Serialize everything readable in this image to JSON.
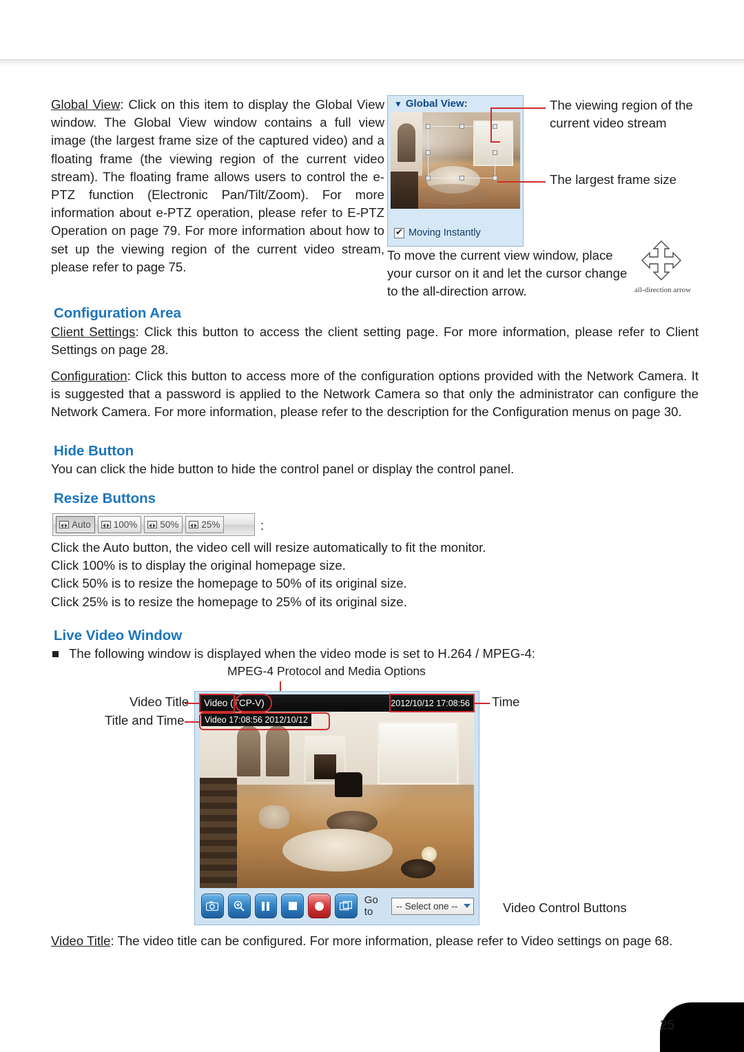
{
  "page": {
    "number": "25"
  },
  "intro": {
    "label": "Global View",
    "text": ": Click on this item to display the Global View window. The Global View window contains a full view image (the largest frame size of the captured video) and a floating frame (the viewing region of the current video stream). The floating frame allows users to control the e-PTZ function (Electronic Pan/Tilt/Zoom). For more information about e-PTZ operation, please refer to E-PTZ Operation on page 79. For more information about how to set up the viewing region of the current video stream, please refer to page 75."
  },
  "global_view_figure": {
    "title": "Global View:",
    "checkbox_label": "Moving Instantly",
    "annotations": {
      "viewing_region": "The viewing region of the current video stream",
      "largest_frame": "The largest frame size",
      "move_view": "To move the current view window, place your cursor on it and let the cursor change to the all-direction arrow.",
      "arrow_caption": "all-direction arrow"
    }
  },
  "configuration_area": {
    "heading": "Configuration Area",
    "client_settings_label": "Client Settings",
    "client_settings_text": ": Click this button to access the client setting page. For more information, please refer to Client Settings on page 28.",
    "configuration_label": "Configuration",
    "configuration_text": ": Click this button to access more of the configuration options provided with the Network Camera. It is suggested that a password is applied to the Network Camera so that only the administrator can configure the Network Camera. For more information, please refer to the description for the Configuration menus on page 30."
  },
  "hide_button": {
    "heading": "Hide Button",
    "text": "You can click the hide button to hide the control panel or display the control panel."
  },
  "resize_buttons": {
    "heading": "Resize Buttons",
    "buttons": [
      "Auto",
      "100%",
      "50%",
      "25%"
    ],
    "colon": ":",
    "lines": [
      "Click the Auto button, the video cell will resize automatically to fit the monitor.",
      "Click 100% is to display the original homepage size.",
      "Click 50% is to resize the homepage to 50% of its original size.",
      "Click 25% is to resize the homepage to 25% of its original size."
    ]
  },
  "live_video_window": {
    "heading": "Live Video Window",
    "bullet_text": "The following window is displayed when the video mode is set to H.264 / MPEG-4:",
    "figure": {
      "caption_protocol": "MPEG-4 Protocol and Media Options",
      "title_video": "Video",
      "title_protocol": "(TCP-V)",
      "time_badge": "2012/10/12 17:08:56",
      "osd_text": "Video 17:08:56  2012/10/12",
      "goto_label": "Go to",
      "goto_value": "-- Select one --",
      "labels": {
        "video_title": "Video Title",
        "title_and_time": "Title and Time",
        "time": "Time",
        "video_control_buttons": "Video Control Buttons"
      },
      "control_icons": [
        "snapshot-icon",
        "zoom-icon",
        "pause-icon",
        "stop-icon",
        "record-icon",
        "fullscreen-icon"
      ]
    }
  },
  "video_title_note": {
    "label": "Video Title",
    "text": ": The video title can be configured. For more information, please refer to Video settings on page 68."
  }
}
